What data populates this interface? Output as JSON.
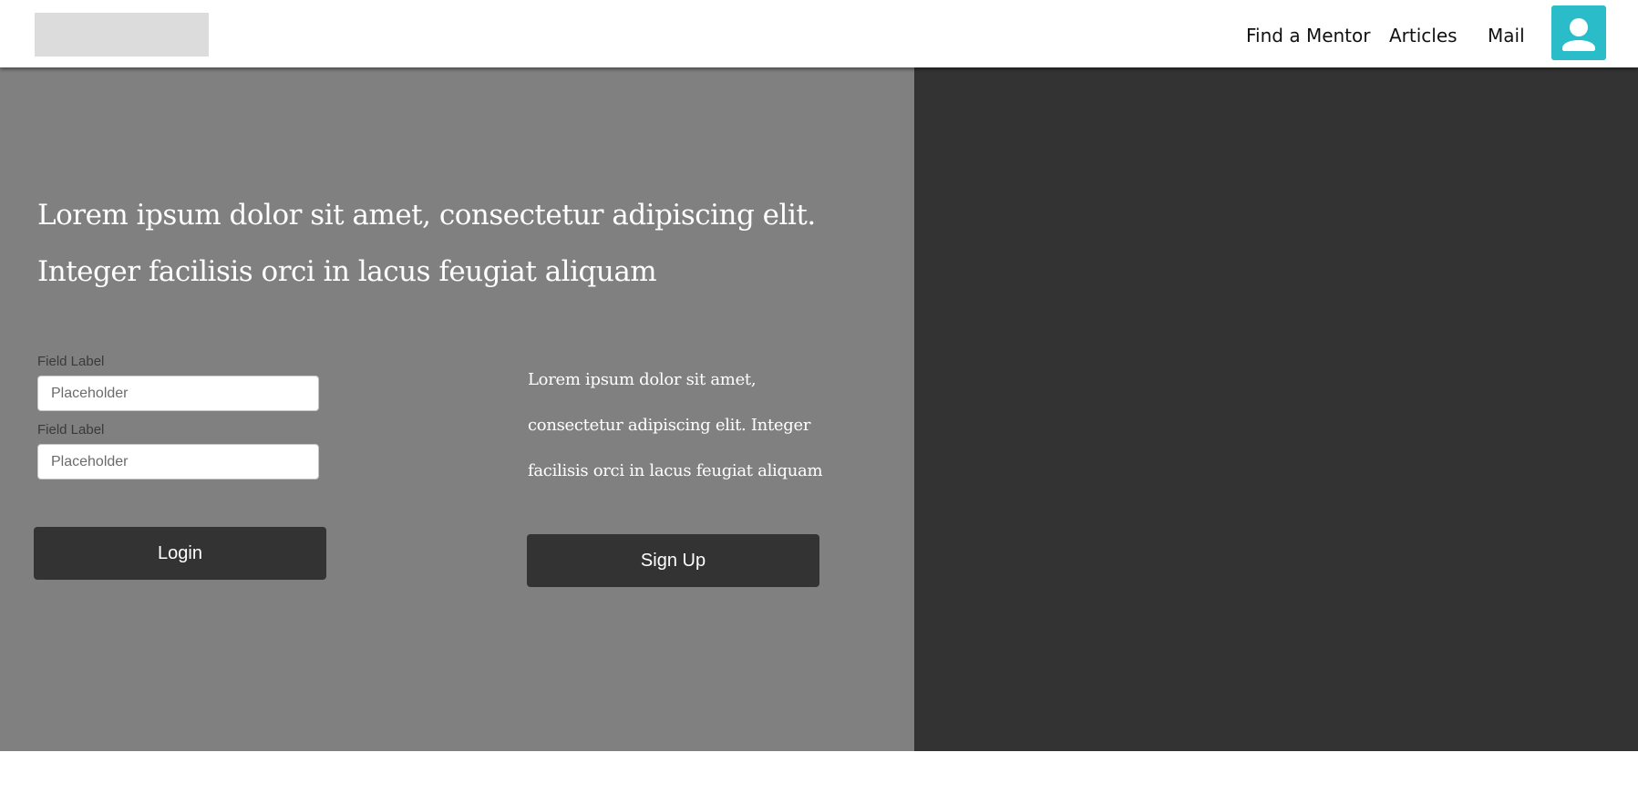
{
  "colors": {
    "navbar_bg": "#ffffff",
    "logo_placeholder": "#dcdcdc",
    "left_panel_bg": "#808080",
    "right_panel_bg": "#333333",
    "button_bg": "#333333",
    "profile_accent": "#2bbcc9"
  },
  "nav": {
    "links": [
      "Find a Mentor",
      "Articles",
      "Mail"
    ],
    "profile_icon": "user-icon"
  },
  "hero": {
    "headline_line1": "Lorem ipsum dolor sit amet, consectetur adipiscing elit.",
    "headline_line2": "Integer facilisis orci in lacus feugiat aliquam"
  },
  "login_form": {
    "fields": [
      {
        "label": "Field Label",
        "placeholder": "Placeholder",
        "value": ""
      },
      {
        "label": "Field Label",
        "placeholder": "Placeholder",
        "value": ""
      }
    ],
    "submit_label": "Login"
  },
  "signup": {
    "text": "Lorem ipsum dolor sit amet, consectetur adipiscing elit. Integer facilisis orci in lacus feugiat aliquam",
    "button_label": "Sign Up"
  }
}
